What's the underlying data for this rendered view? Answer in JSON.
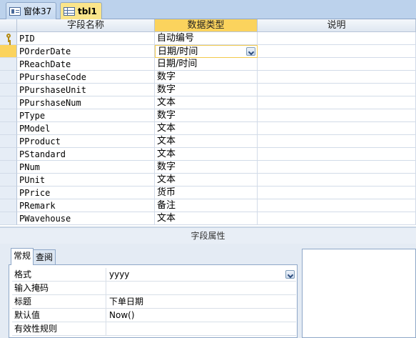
{
  "tabs": [
    {
      "label": "窗体37",
      "icon": "form-icon",
      "active": false
    },
    {
      "label": "tbl1",
      "icon": "table-icon",
      "active": true
    }
  ],
  "grid": {
    "headers": {
      "field_name": "字段名称",
      "data_type": "数据类型",
      "description": "说明"
    },
    "rows": [
      {
        "name": "PID",
        "type": "自动编号",
        "primary_key": true
      },
      {
        "name": "POrderDate",
        "type": "日期/时间",
        "current": true
      },
      {
        "name": "PReachDate",
        "type": "日期/时间"
      },
      {
        "name": "PPurshaseCode",
        "type": "数字"
      },
      {
        "name": "PPurshaseUnit",
        "type": "数字"
      },
      {
        "name": "PPurshaseNum",
        "type": "文本"
      },
      {
        "name": "PType",
        "type": "数字"
      },
      {
        "name": "PModel",
        "type": "文本"
      },
      {
        "name": "PProduct",
        "type": "文本"
      },
      {
        "name": "PStandard",
        "type": "文本"
      },
      {
        "name": "PNum",
        "type": "数字"
      },
      {
        "name": "PUnit",
        "type": "文本"
      },
      {
        "name": "PPrice",
        "type": "货币"
      },
      {
        "name": "PRemark",
        "type": "备注"
      },
      {
        "name": "PWavehouse",
        "type": "文本"
      }
    ]
  },
  "properties": {
    "section_title": "字段属性",
    "tabs": [
      "常规",
      "查阅"
    ],
    "active_tab": "常规",
    "rows": [
      {
        "label": "格式",
        "value": "yyyy",
        "dropdown": true
      },
      {
        "label": "输入掩码",
        "value": ""
      },
      {
        "label": "标题",
        "value": "下单日期"
      },
      {
        "label": "默认值",
        "value": "Now()"
      },
      {
        "label": "有效性规则",
        "value": ""
      }
    ]
  },
  "colors": {
    "accent": "#fbd35d",
    "tab_bar": "#bcd2ec",
    "border": "#8ea7c8"
  }
}
